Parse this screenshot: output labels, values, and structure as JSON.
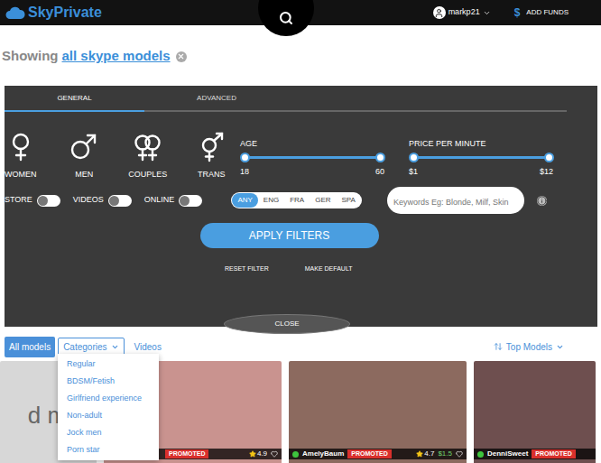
{
  "header": {
    "logo": "SkyPrivate",
    "user": "markp21",
    "add_funds_icon": "$",
    "add_funds": "ADD FUNDS"
  },
  "showing": {
    "prefix": "Showing",
    "link": "all skype models"
  },
  "filter_panel": {
    "tabs": [
      {
        "label": "GENERAL",
        "selected": true
      },
      {
        "label": "ADVANCED",
        "selected": false
      }
    ],
    "genders": [
      {
        "label": "WOMEN",
        "kind": "women"
      },
      {
        "label": "MEN",
        "kind": "men"
      },
      {
        "label": "COUPLES",
        "kind": "couples"
      },
      {
        "label": "TRANS",
        "kind": "trans"
      }
    ],
    "sliders": [
      {
        "label": "AGE",
        "min": "18",
        "max": "60",
        "low": 0,
        "high": 1
      },
      {
        "label": "PRICE PER MINUTE",
        "min": "$1",
        "max": "$12",
        "low": 0,
        "high": 1
      }
    ],
    "toggles": [
      {
        "label": "STORE",
        "on": false
      },
      {
        "label": "VIDEOS",
        "on": false
      },
      {
        "label": "ONLINE",
        "on": false
      }
    ],
    "languages": [
      {
        "label": "ANY",
        "selected": true
      },
      {
        "label": "ENG",
        "selected": false
      },
      {
        "label": "FRA",
        "selected": false
      },
      {
        "label": "GER",
        "selected": false
      },
      {
        "label": "SPA",
        "selected": false
      }
    ],
    "keywords": {
      "placeholder": "Keywords Eg: Blonde, Milf, Skin"
    },
    "apply": "APPLY FILTERS",
    "links": [
      "RESET FILTER",
      "MAKE DEFAULT"
    ],
    "close": "CLOSE"
  },
  "toolbar": {
    "all_models": "All models",
    "categories": "Categories",
    "videos": "Videos",
    "sort": "Top Models"
  },
  "categories_menu": [
    "Regular",
    "BDSM/Fetish",
    "Girlfriend experience",
    "Non-adult",
    "Jock men",
    "Porn star"
  ],
  "models": [
    {
      "kind": "banner",
      "text": "d mod"
    },
    {
      "kind": "model",
      "name": "",
      "online": false,
      "promoted": "PROMOTED",
      "rating": "4.9",
      "price": ""
    },
    {
      "kind": "model",
      "name": "AmelyBaum",
      "online": true,
      "promoted": "PROMOTED",
      "rating": "4.7",
      "price": "$1.5"
    },
    {
      "kind": "model",
      "name": "DenniSweet",
      "online": true,
      "promoted": "PROMOTED",
      "rating": "",
      "price": ""
    }
  ]
}
